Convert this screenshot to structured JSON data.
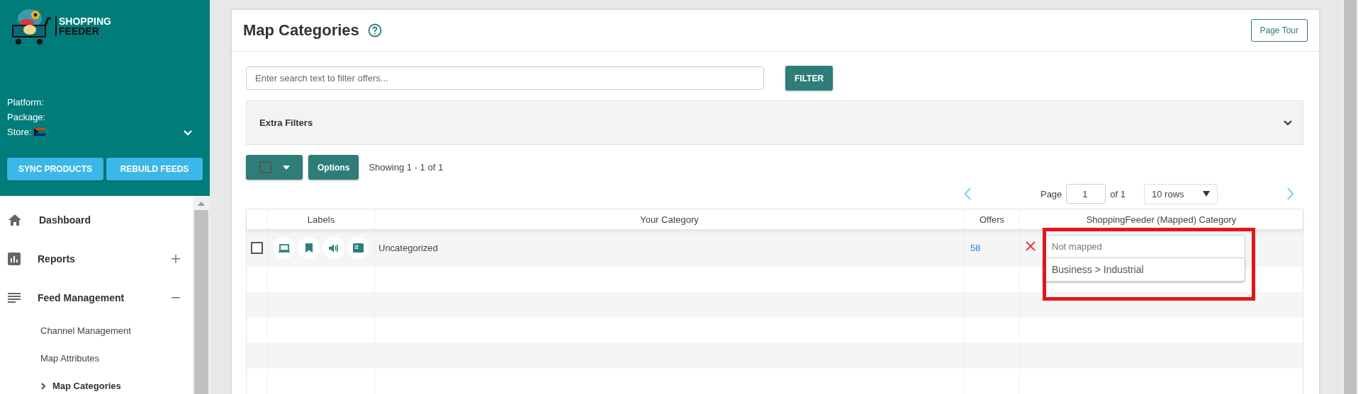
{
  "sidebar": {
    "logo": {
      "line_1": "SHOPPING",
      "line_2": "FEEDER"
    },
    "info": [
      {
        "label": "Platform:"
      },
      {
        "label": "Package:"
      },
      {
        "label": "Store:"
      }
    ],
    "store_expanded": false,
    "actions": [
      "SYNC PRODUCTS",
      "REBUILD FEEDS"
    ],
    "menu": [
      {
        "label": "Dashboard",
        "kind": "link"
      },
      {
        "label": "Reports",
        "kind": "group",
        "expanded": false
      },
      {
        "label": "Feed Management",
        "kind": "group",
        "expanded": true,
        "children": [
          {
            "label": "Channel Management",
            "selected": false
          },
          {
            "label": "Map Attributes",
            "selected": false
          },
          {
            "label": "Map Categories",
            "selected": true
          }
        ]
      }
    ]
  },
  "page": {
    "title": "Map Categories",
    "tour_button": "Page Tour",
    "search": {
      "placeholder": "Enter search text to filter offers..."
    },
    "filter_button": "FILTER",
    "extra_filters": {
      "label": "Extra Filters",
      "expanded": false
    },
    "toolbar": {
      "select_all_checked": false,
      "options_button": "Options",
      "showing": "Showing 1 - 1 of 1"
    },
    "pagination": {
      "page_label": "Page",
      "page": "1",
      "of": "of 1",
      "rows": "10 rows"
    },
    "table": {
      "columns": [
        "Labels",
        "Your Category",
        "Offers",
        "ShoppingFeeder (Mapped) Category"
      ],
      "rows": [
        {
          "checked": false,
          "category": "Uncategorized",
          "offers": "58",
          "mapped": {
            "placeholder": "Not mapped",
            "suggestion": "Business > Industrial",
            "highlighted": true
          }
        }
      ]
    }
  }
}
